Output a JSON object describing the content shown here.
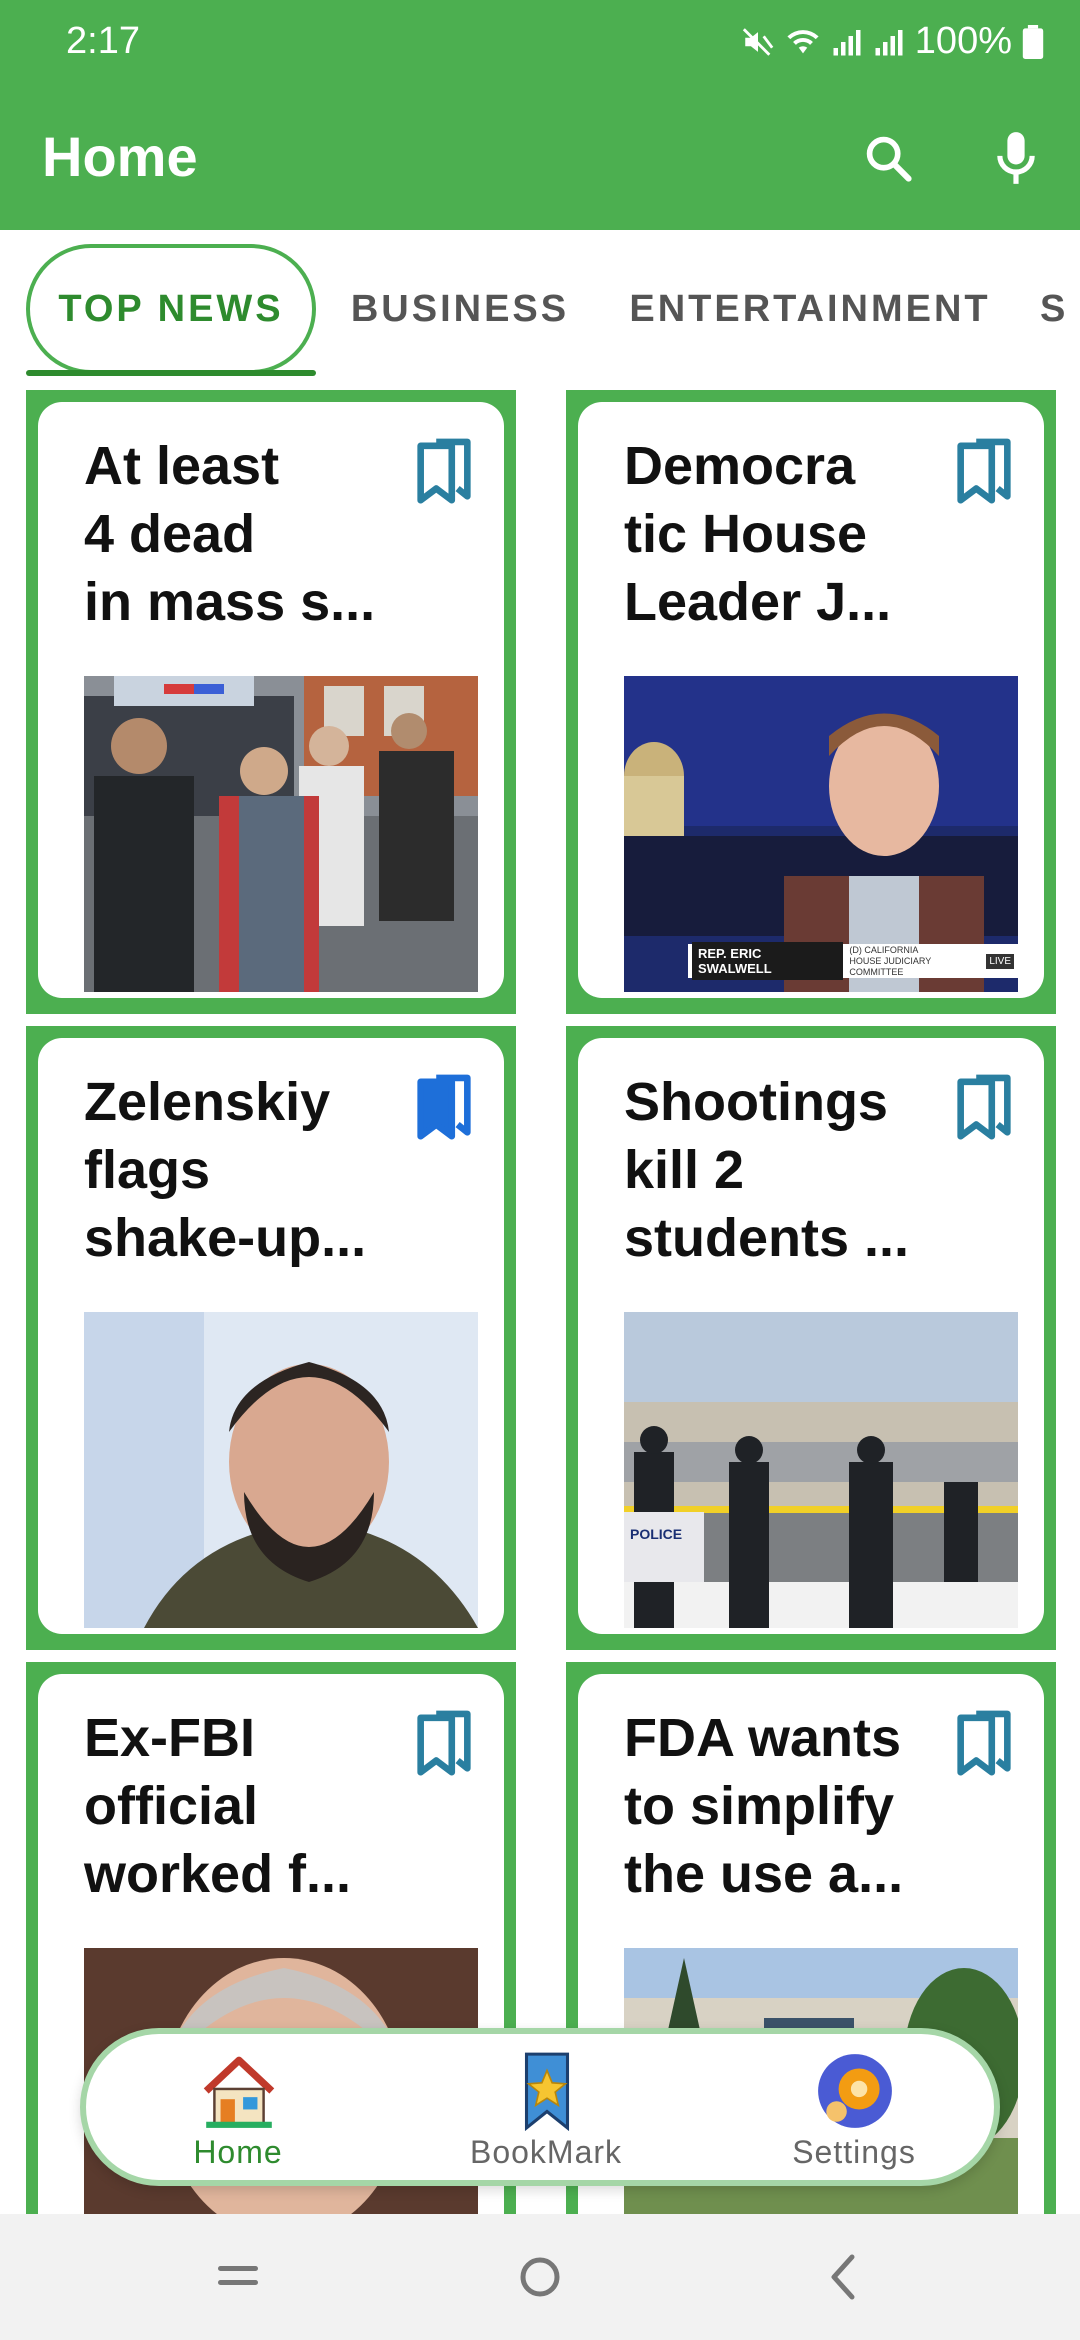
{
  "status_bar": {
    "time": "2:17",
    "battery": "100%"
  },
  "app_bar": {
    "title": "Home",
    "search_icon": "search-icon",
    "mic_icon": "mic-icon"
  },
  "tabs": [
    {
      "label": "TOP NEWS",
      "selected": true
    },
    {
      "label": "BUSINESS",
      "selected": false
    },
    {
      "label": "ENTERTAINMENT",
      "selected": false
    },
    {
      "label": "S",
      "selected": false
    }
  ],
  "articles": [
    {
      "title": "At least\n4 dead\nin mass s...",
      "bookmarked": false
    },
    {
      "title": "Democra\ntic House\nLeader J...",
      "bookmarked": false
    },
    {
      "title": "Zelenskiy\nflags\nshake-up...",
      "bookmarked": true
    },
    {
      "title": "Shootings\nkill 2\nstudents ...",
      "bookmarked": false
    },
    {
      "title": "Ex-FBI\nofficial\nworked f...",
      "bookmarked": false
    },
    {
      "title": "FDA wants\nto simplify\nthe use a...",
      "bookmarked": false
    }
  ],
  "image_captions": {
    "news_lower_third_name": "REP. ERIC SWALWELL",
    "news_lower_third_detail_1": "(D) CALIFORNIA",
    "news_lower_third_detail_2": "HOUSE JUDICIARY COMMITTEE",
    "police_car_text": "POLICE",
    "live_badge": "LIVE"
  },
  "bottom_nav": [
    {
      "label": "Home",
      "icon": "house-icon",
      "active": true
    },
    {
      "label": "BookMark",
      "icon": "bookmark-star-icon",
      "active": false
    },
    {
      "label": "Settings",
      "icon": "settings-gear-icon",
      "active": false
    }
  ],
  "colors": {
    "primary": "#4caf50",
    "active_text": "#2e8b2e",
    "bookmark_outline": "#2a7fa0",
    "bookmark_filled": "#1e6fd9"
  }
}
